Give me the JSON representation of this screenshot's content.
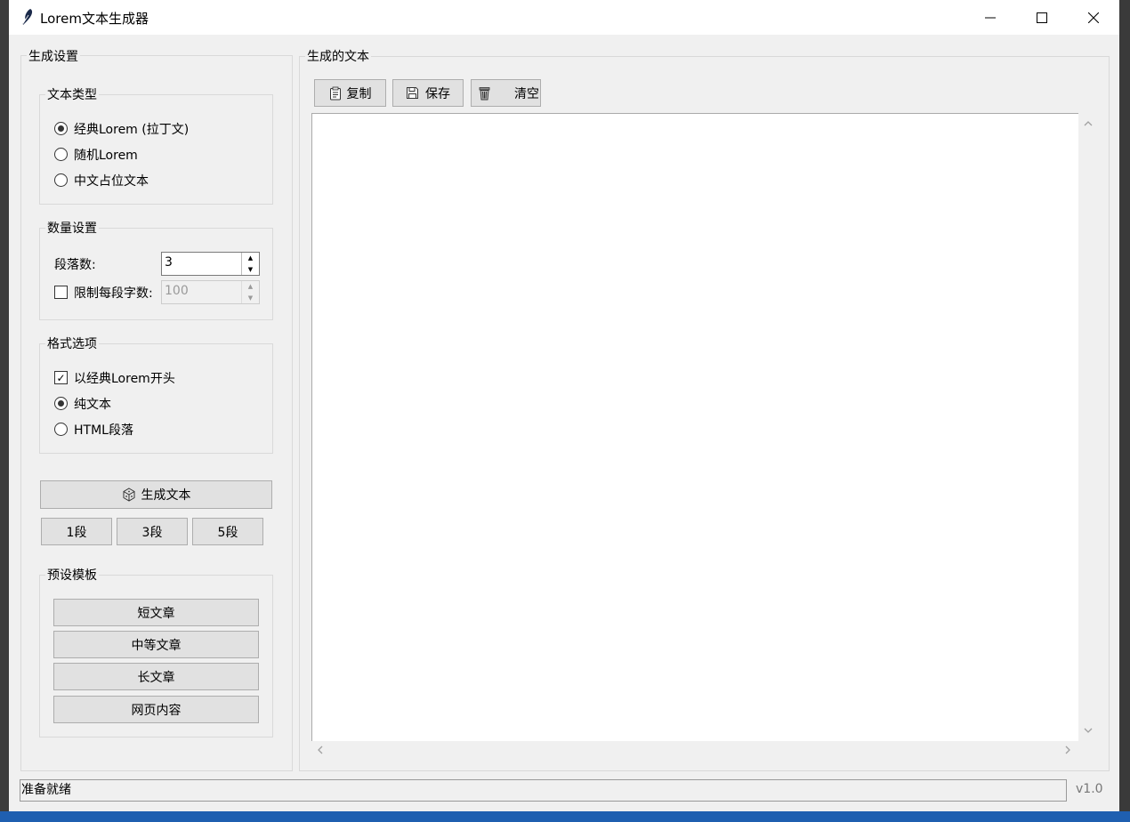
{
  "window": {
    "title": "Lorem文本生成器",
    "controls": {
      "minimize": "—",
      "maximize": "☐",
      "close": "✕"
    }
  },
  "left_panel": {
    "title": "生成设置",
    "text_type": {
      "title": "文本类型",
      "options": [
        {
          "label": "经典Lorem (拉丁文)",
          "selected": true
        },
        {
          "label": "随机Lorem",
          "selected": false
        },
        {
          "label": "中文占位文本",
          "selected": false
        }
      ]
    },
    "quantity": {
      "title": "数量设置",
      "paragraphs_label": "段落数:",
      "paragraphs_value": "3",
      "limit_label": "限制每段字数:",
      "limit_checked": false,
      "limit_value": "100"
    },
    "format": {
      "title": "格式选项",
      "start_classic_label": "以经典Lorem开头",
      "start_classic_checked": true,
      "options": [
        {
          "label": "纯文本",
          "selected": true
        },
        {
          "label": "HTML段落",
          "selected": false
        }
      ]
    },
    "generate_button": "生成文本",
    "quick_buttons": [
      "1段",
      "3段",
      "5段"
    ],
    "presets": {
      "title": "预设模板",
      "buttons": [
        "短文章",
        "中等文章",
        "长文章",
        "网页内容"
      ]
    }
  },
  "right_panel": {
    "title": "生成的文本",
    "toolbar": {
      "copy": "复制",
      "save": "保存",
      "clear": "清空"
    },
    "text_content": ""
  },
  "status": {
    "text": "准备就绪",
    "version": "v1.0"
  },
  "icons": {
    "app": "feather-icon",
    "copy": "clipboard-icon",
    "save": "floppy-icon",
    "clear": "trash-icon",
    "generate": "dice-icon"
  }
}
